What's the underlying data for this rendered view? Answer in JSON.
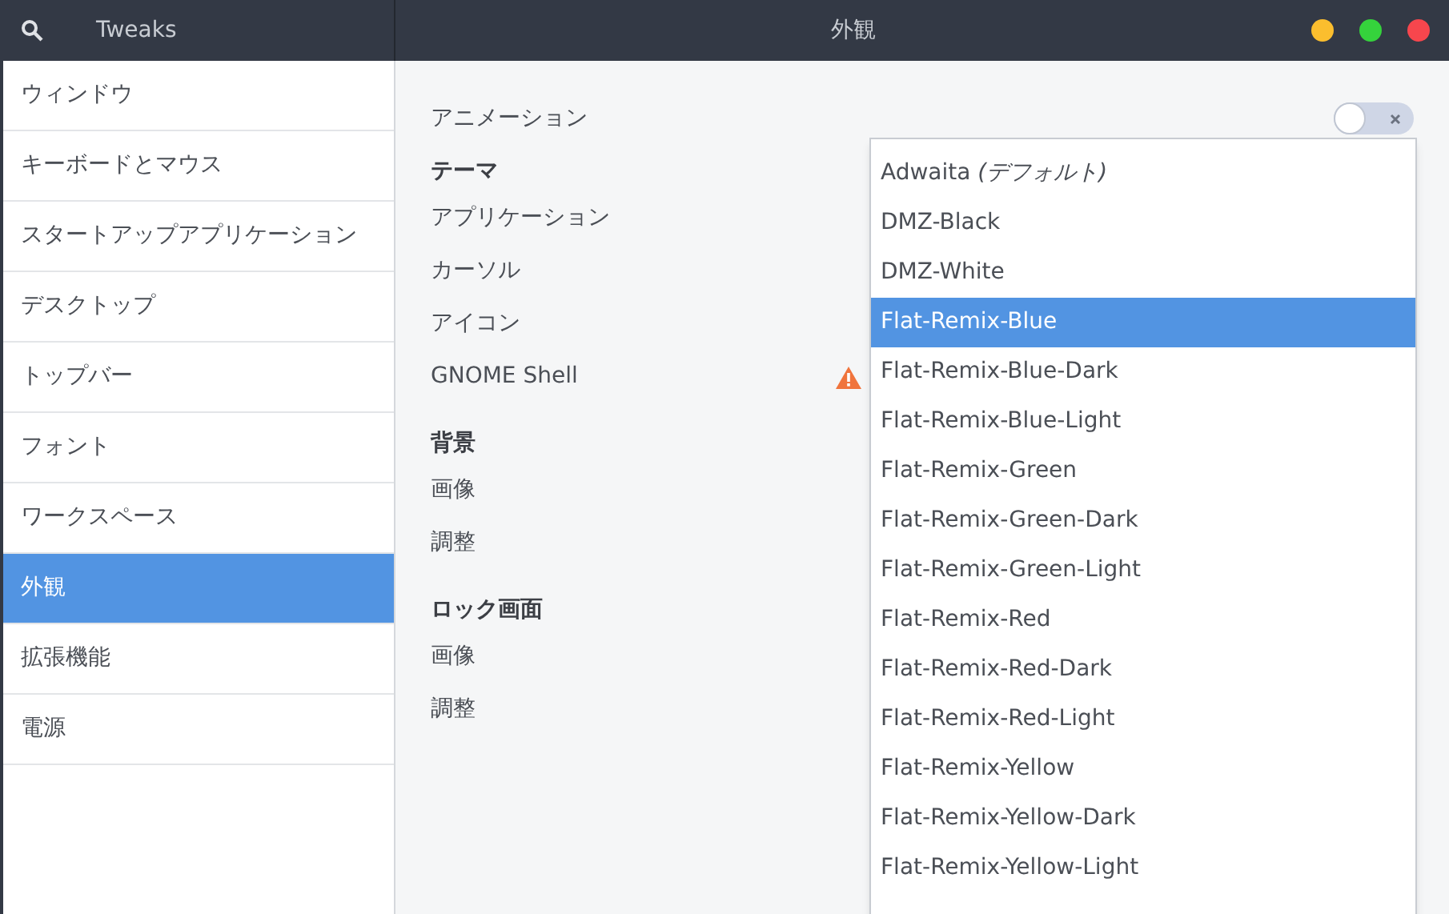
{
  "header": {
    "app_title": "Tweaks",
    "title": "外観"
  },
  "sidebar": {
    "items": [
      {
        "label": "ウィンドウ",
        "selected": false
      },
      {
        "label": "キーボードとマウス",
        "selected": false
      },
      {
        "label": "スタートアップアプリケーション",
        "selected": false
      },
      {
        "label": "デスクトップ",
        "selected": false
      },
      {
        "label": "トップバー",
        "selected": false
      },
      {
        "label": "フォント",
        "selected": false
      },
      {
        "label": "ワークスペース",
        "selected": false
      },
      {
        "label": "外観",
        "selected": true
      },
      {
        "label": "拡張機能",
        "selected": false
      },
      {
        "label": "電源",
        "selected": false
      }
    ]
  },
  "settings": [
    {
      "kind": "switch",
      "label": "アニメーション",
      "on": false
    },
    {
      "kind": "heading",
      "label": "テーマ"
    },
    {
      "kind": "row",
      "label": "アプリケーション"
    },
    {
      "kind": "row",
      "label": "カーソル"
    },
    {
      "kind": "row",
      "label": "アイコン"
    },
    {
      "kind": "row",
      "label": "GNOME Shell",
      "warning": true
    },
    {
      "kind": "heading",
      "label": "背景"
    },
    {
      "kind": "row",
      "label": "画像"
    },
    {
      "kind": "row",
      "label": "調整"
    },
    {
      "kind": "heading",
      "label": "ロック画面"
    },
    {
      "kind": "row",
      "label": "画像"
    },
    {
      "kind": "row",
      "label": "調整"
    }
  ],
  "dropdown": {
    "options": [
      {
        "label": "Adwaita *(デフォルト)*",
        "selected": false
      },
      {
        "label": "DMZ-Black",
        "selected": false
      },
      {
        "label": "DMZ-White",
        "selected": false
      },
      {
        "label": "Flat-Remix-Blue",
        "selected": true
      },
      {
        "label": "Flat-Remix-Blue-Dark",
        "selected": false
      },
      {
        "label": "Flat-Remix-Blue-Light",
        "selected": false
      },
      {
        "label": "Flat-Remix-Green",
        "selected": false
      },
      {
        "label": "Flat-Remix-Green-Dark",
        "selected": false
      },
      {
        "label": "Flat-Remix-Green-Light",
        "selected": false
      },
      {
        "label": "Flat-Remix-Red",
        "selected": false
      },
      {
        "label": "Flat-Remix-Red-Dark",
        "selected": false
      },
      {
        "label": "Flat-Remix-Red-Light",
        "selected": false
      },
      {
        "label": "Flat-Remix-Yellow",
        "selected": false
      },
      {
        "label": "Flat-Remix-Yellow-Dark",
        "selected": false
      },
      {
        "label": "Flat-Remix-Yellow-Light",
        "selected": false
      }
    ]
  }
}
